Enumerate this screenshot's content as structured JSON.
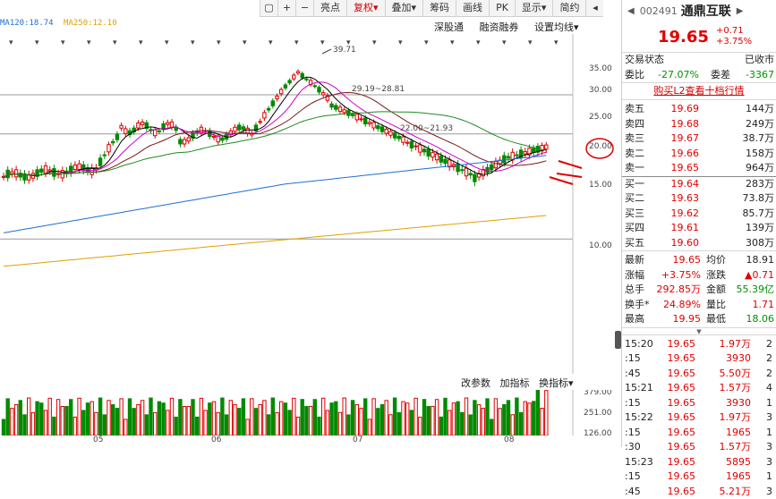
{
  "toolbar": {
    "items": [
      {
        "label": "",
        "icon": "box-icon"
      },
      {
        "label": "+",
        "icon": "plus-icon"
      },
      {
        "label": "−",
        "icon": "minus-icon"
      },
      {
        "label": "亮点"
      },
      {
        "label": "复权▾",
        "active": true
      },
      {
        "label": "叠加▾"
      },
      {
        "label": "筹码"
      },
      {
        "label": "画线"
      },
      {
        "label": "PK"
      },
      {
        "label": "显示▾"
      },
      {
        "label": "简约"
      },
      {
        "label": "",
        "icon": "collapse-icon"
      }
    ]
  },
  "ma_legend": [
    "MA120:18.74",
    "MA250:12.10"
  ],
  "chart_buttons": [
    "深股通",
    "融资融券",
    "设置均线▾"
  ],
  "indicator_buttons": [
    "改参数",
    "加指标",
    "换指标▾"
  ],
  "annotations": [
    "39.71",
    "29.19~28.81",
    "22.00~21.93"
  ],
  "price_axis": [
    "35.00",
    "30.00",
    "25.00",
    "20.00",
    "15.00",
    "10.00"
  ],
  "volume_axis": [
    "379.00",
    "251.00",
    "126.00"
  ],
  "date_axis": [
    "05",
    "06",
    "07",
    "08"
  ],
  "stock": {
    "code": "002491",
    "name": "通鼎互联",
    "price": "19.65",
    "change": "+0.71",
    "change_pct": "+3.75%"
  },
  "status": {
    "label": "交易状态",
    "value": "已收市"
  },
  "weibi": {
    "label": "委比",
    "value": "-27.07%",
    "diff_label": "委差",
    "diff_value": "-3367"
  },
  "link": "购买L2查看十档行情",
  "asks": [
    {
      "label": "卖五",
      "price": "19.69",
      "vol": "144万"
    },
    {
      "label": "卖四",
      "price": "19.68",
      "vol": "249万"
    },
    {
      "label": "卖三",
      "price": "19.67",
      "vol": "38.7万"
    },
    {
      "label": "卖二",
      "price": "19.66",
      "vol": "158万"
    },
    {
      "label": "卖一",
      "price": "19.65",
      "vol": "964万"
    }
  ],
  "bids": [
    {
      "label": "买一",
      "price": "19.64",
      "vol": "283万"
    },
    {
      "label": "买二",
      "price": "19.63",
      "vol": "73.8万"
    },
    {
      "label": "买三",
      "price": "19.62",
      "vol": "85.7万"
    },
    {
      "label": "买四",
      "price": "19.61",
      "vol": "139万"
    },
    {
      "label": "买五",
      "price": "19.60",
      "vol": "308万"
    }
  ],
  "stats": [
    {
      "l1": "最新",
      "v1": "19.65",
      "l2": "均价",
      "v2": "18.91"
    },
    {
      "l1": "涨幅",
      "v1": "+3.75%",
      "l2": "涨跌",
      "v2": "▲0.71"
    },
    {
      "l1": "总手",
      "v1": "292.85万",
      "l2": "金额",
      "v2": "55.39亿"
    },
    {
      "l1": "换手*",
      "v1": "24.89%",
      "l2": "量比",
      "v2": "1.71"
    },
    {
      "l1": "最高",
      "v1": "19.95",
      "l2": "最低",
      "v2": "18.06"
    }
  ],
  "ticks": [
    {
      "time": "15:20",
      "price": "19.65",
      "vol": "1.97万",
      "n": "2"
    },
    {
      "time": ":15",
      "price": "19.65",
      "vol": "3930",
      "n": "2"
    },
    {
      "time": ":45",
      "price": "19.65",
      "vol": "5.50万",
      "n": "2"
    },
    {
      "time": "15:21",
      "price": "19.65",
      "vol": "1.57万",
      "n": "4"
    },
    {
      "time": ":15",
      "price": "19.65",
      "vol": "3930",
      "n": "1"
    },
    {
      "time": "15:22",
      "price": "19.65",
      "vol": "1.97万",
      "n": "3"
    },
    {
      "time": ":15",
      "price": "19.65",
      "vol": "1965",
      "n": "1"
    },
    {
      "time": ":30",
      "price": "19.65",
      "vol": "1.57万",
      "n": "3"
    },
    {
      "time": "15:23",
      "price": "19.65",
      "vol": "5895",
      "n": "3"
    },
    {
      "time": ":15",
      "price": "19.65",
      "vol": "1965",
      "n": "1"
    },
    {
      "time": ":45",
      "price": "19.65",
      "vol": "5.21万",
      "n": "3"
    }
  ],
  "colors": {
    "up": "#e00000",
    "down": "#008a00",
    "ma5": "#000000",
    "ma10": "#d100c9",
    "ma20": "#7a1a1a",
    "ma60": "#1e8a1e",
    "ma120": "#1f6fd1",
    "ma250": "#e0a000"
  }
}
